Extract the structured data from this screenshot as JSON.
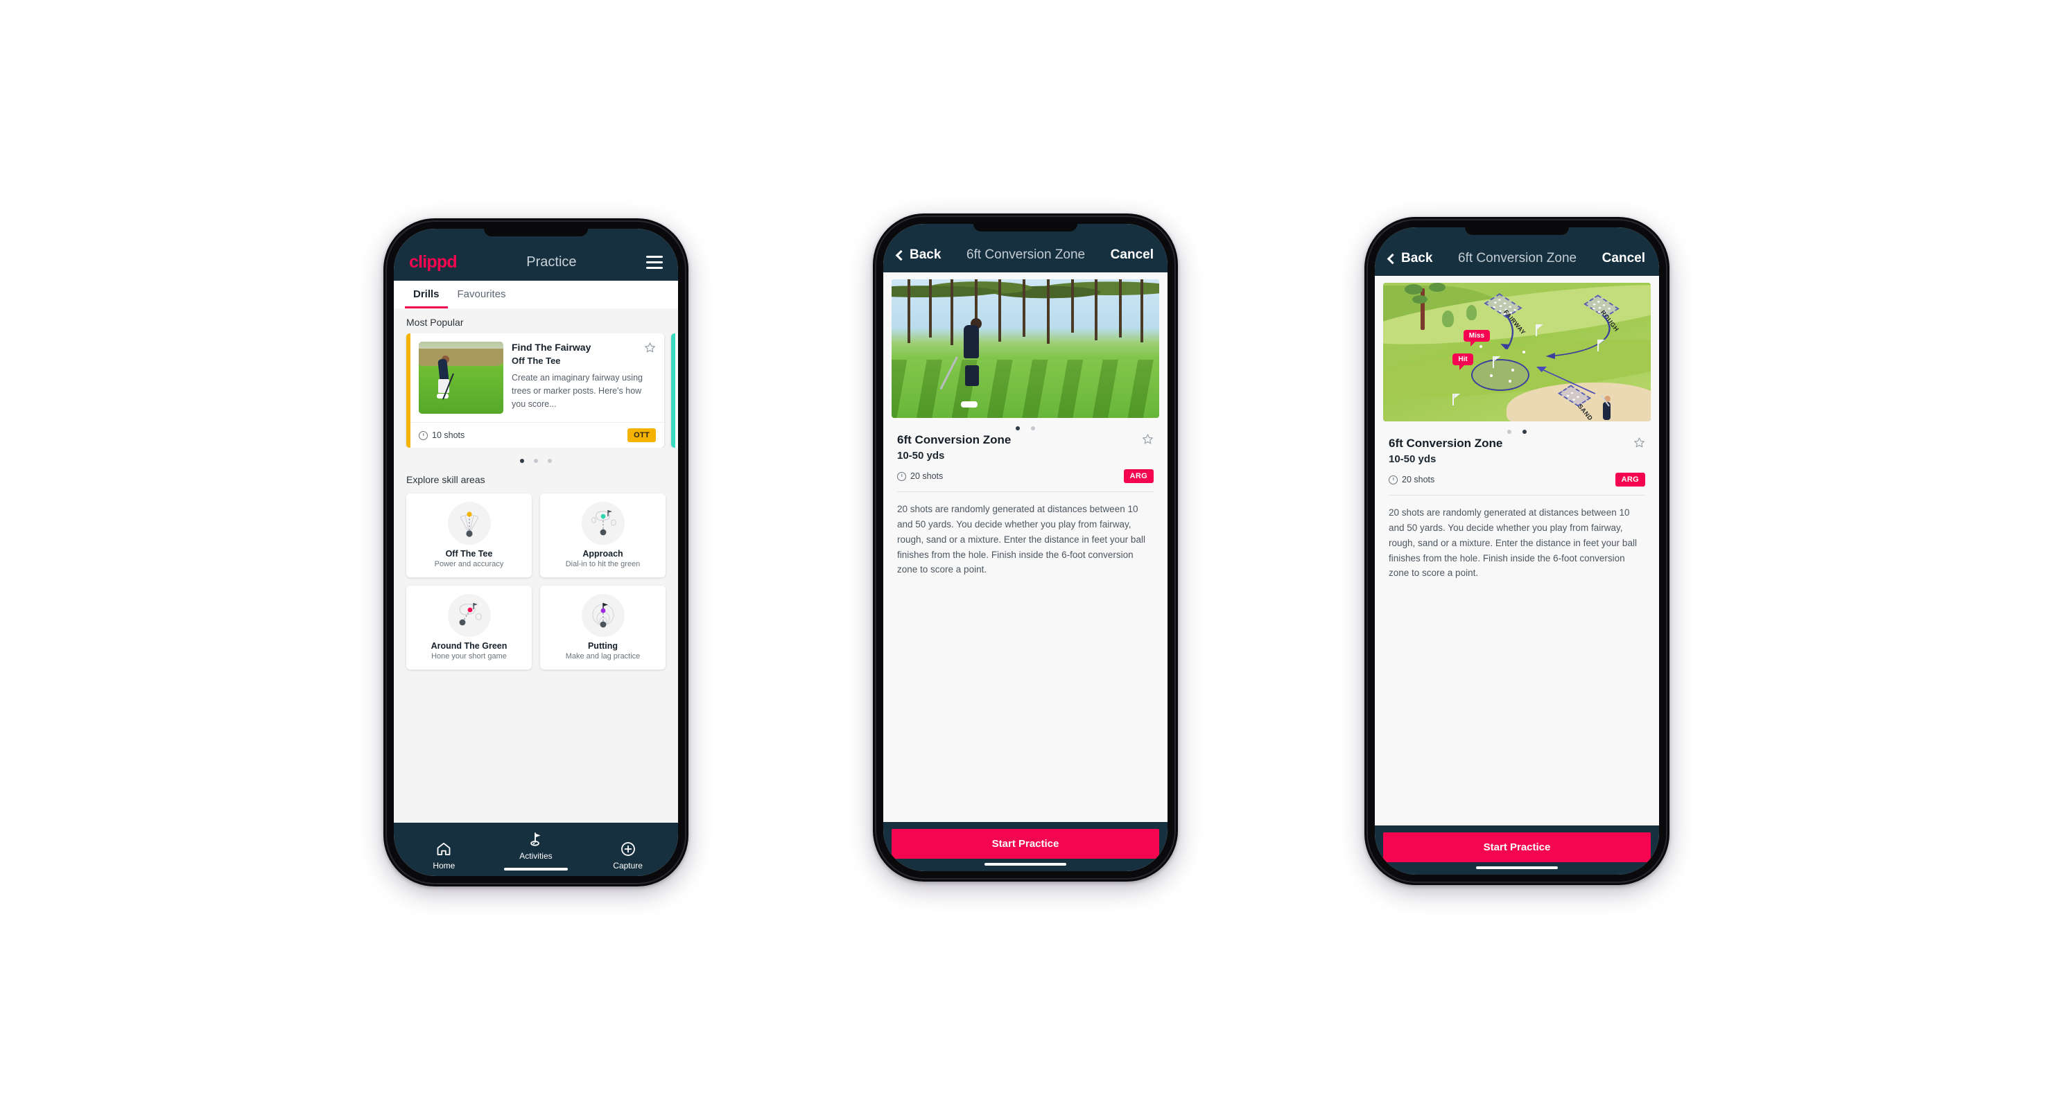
{
  "screens": {
    "practice": {
      "brand": "clippd",
      "title": "Practice",
      "menu_icon": "hamburger-icon",
      "tabs": [
        {
          "label": "Drills",
          "active": true
        },
        {
          "label": "Favourites",
          "active": false
        }
      ],
      "most_popular_heading": "Most Popular",
      "drill_card": {
        "title": "Find The Fairway",
        "subtitle": "Off The Tee",
        "description": "Create an imaginary fairway using trees or marker posts. Here's how you score...",
        "shots": "10 shots",
        "chip": "OTT",
        "chip_color": "#f5b301",
        "accent_color": "#f5b301",
        "favourite_icon": "star-outline-icon"
      },
      "next_card_accent": "#3ddbc0",
      "carousel_dots": {
        "count": 3,
        "active": 0
      },
      "explore_heading": "Explore skill areas",
      "skills": [
        {
          "name": "Off The Tee",
          "desc": "Power and accuracy",
          "icon": "tee-dispersion-icon",
          "dot_color": "#f5b301"
        },
        {
          "name": "Approach",
          "desc": "Dial-in to hit the green",
          "icon": "approach-green-icon",
          "dot_color": "#2fd6b0"
        },
        {
          "name": "Around The Green",
          "desc": "Hone your short game",
          "icon": "chip-to-green-icon",
          "dot_color": "#f5054f"
        },
        {
          "name": "Putting",
          "desc": "Make and lag practice",
          "icon": "putting-rings-icon",
          "dot_color": "#a028e0"
        }
      ],
      "bottom_nav": [
        {
          "label": "Home",
          "icon": "home-icon",
          "active": false
        },
        {
          "label": "Activities",
          "icon": "flag-icon",
          "active": true
        },
        {
          "label": "Capture",
          "icon": "plus-circle-icon",
          "active": false
        }
      ]
    },
    "detail_video": {
      "back_label": "Back",
      "back_icon": "chevron-left-icon",
      "nav_title": "6ft Conversion Zone",
      "cancel_label": "Cancel",
      "media_type": "photo",
      "media_alt": "golfer chipping on a tree-lined course",
      "carousel_dots": {
        "count": 2,
        "active": 0
      },
      "title": "6ft Conversion Zone",
      "range": "10-50 yds",
      "shots": "20 shots",
      "chip": "ARG",
      "chip_color": "#f5054f",
      "favourite_icon": "star-outline-icon",
      "description": "20 shots are randomly generated at distances between 10 and 50 yards. You decide whether you play from fairway, rough, sand or a mixture. Enter the distance in feet your ball finishes from the hole. Finish inside the 6-foot conversion zone to score a point.",
      "cta_label": "Start Practice"
    },
    "detail_diagram": {
      "back_label": "Back",
      "back_icon": "chevron-left-icon",
      "nav_title": "6ft Conversion Zone",
      "cancel_label": "Cancel",
      "media_type": "illustration",
      "media_alt": "isometric golf hole diagram with fairway, rough and sand start zones",
      "diagram_labels": {
        "fairway": "FAIRWAY",
        "rough": "ROUGH",
        "sand": "SAND",
        "miss": "Miss",
        "hit": "Hit"
      },
      "carousel_dots": {
        "count": 2,
        "active": 1
      },
      "title": "6ft Conversion Zone",
      "range": "10-50 yds",
      "shots": "20 shots",
      "chip": "ARG",
      "chip_color": "#f5054f",
      "favourite_icon": "star-outline-icon",
      "description": "20 shots are randomly generated at distances between 10 and 50 yards. You decide whether you play from fairway, rough, sand or a mixture. Enter the distance in feet your ball finishes from the hole. Finish inside the 6-foot conversion zone to score a point.",
      "cta_label": "Start Practice"
    }
  },
  "theme": {
    "header_navy": "#17303f",
    "accent_pink": "#f5054f",
    "amber": "#f5b301",
    "teal": "#3ddbc0",
    "page_bg": "#f4f4f5"
  }
}
